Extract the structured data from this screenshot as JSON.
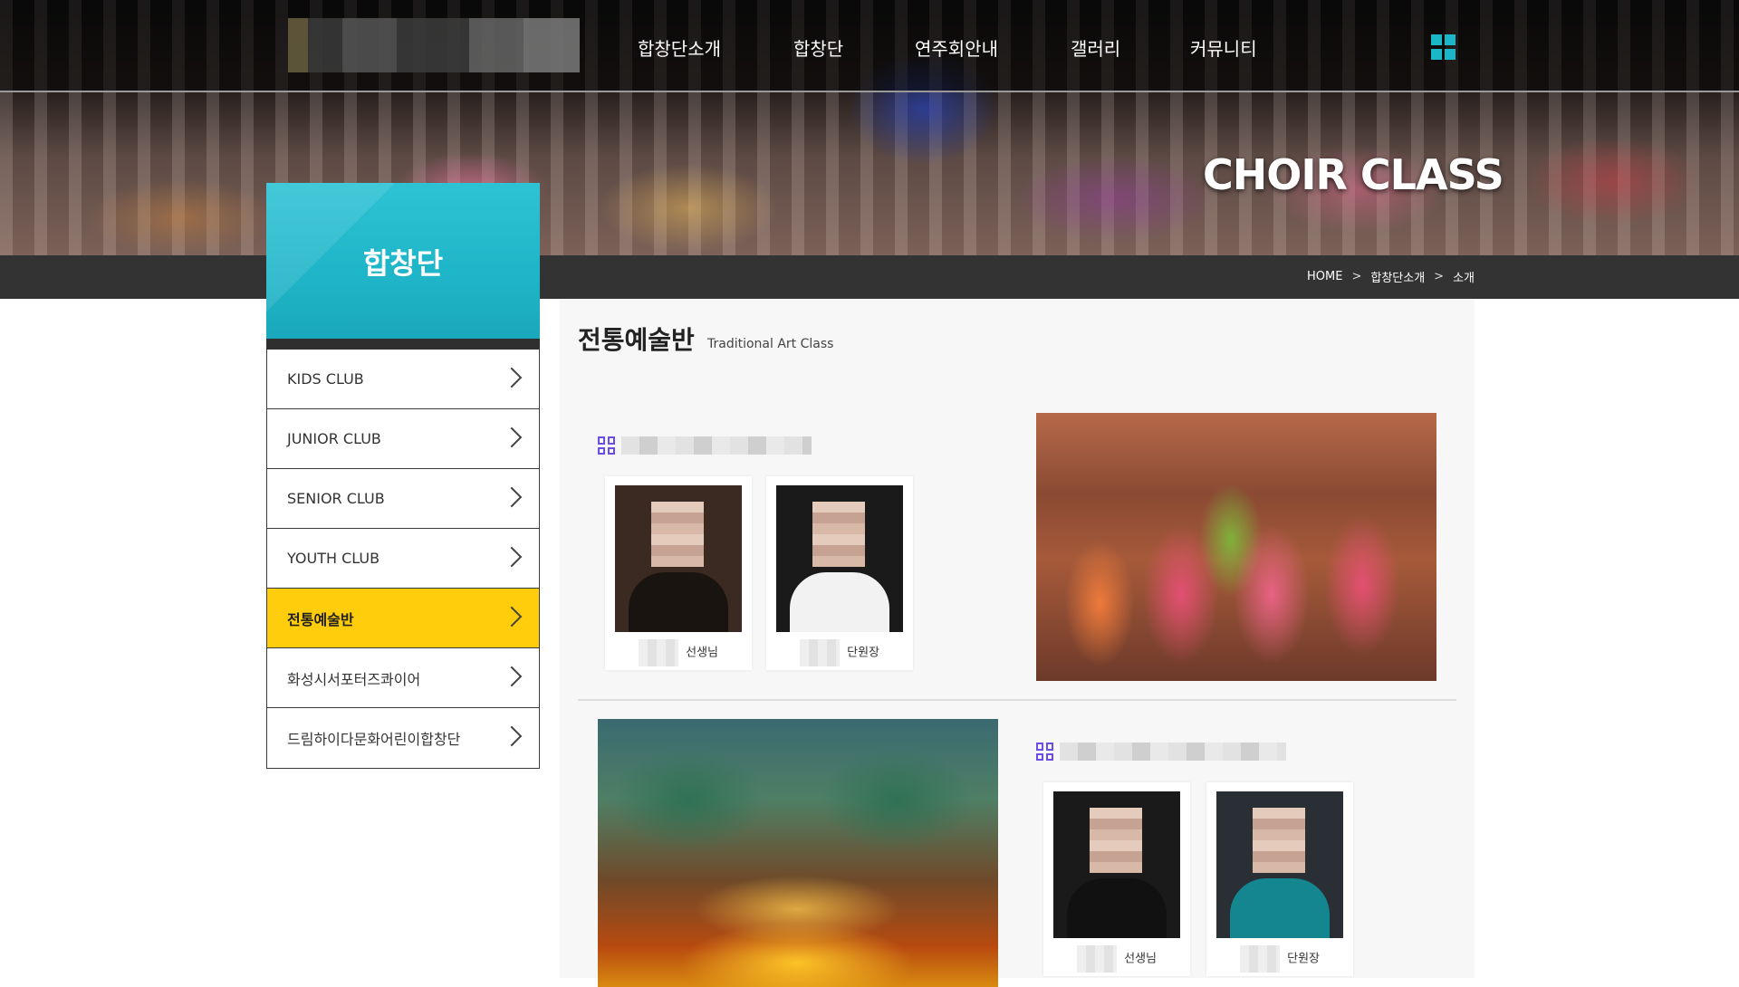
{
  "nav": {
    "items": [
      "합창단소개",
      "합창단",
      "연주회안내",
      "갤러리",
      "커뮤니티"
    ]
  },
  "hero": {
    "title": "CHOIR CLASS"
  },
  "breadcrumb": {
    "home": "HOME",
    "sep": ">",
    "level1": "합창단소개",
    "level2": "소개"
  },
  "sidebar": {
    "title": "합창단",
    "items": [
      {
        "label": "KIDS CLUB",
        "active": false
      },
      {
        "label": "JUNIOR CLUB",
        "active": false
      },
      {
        "label": "SENIOR CLUB",
        "active": false
      },
      {
        "label": "YOUTH CLUB",
        "active": false
      },
      {
        "label": "전통예술반",
        "active": true
      },
      {
        "label": "화성시서포터즈콰이어",
        "active": false
      },
      {
        "label": "드림하이다문화어린이합창단",
        "active": false
      }
    ]
  },
  "content": {
    "title": "전통예술반",
    "subtitle": "Traditional Art Class",
    "group1": {
      "members": [
        {
          "role": "선생님"
        },
        {
          "role": "단원장"
        }
      ]
    },
    "group2": {
      "members": [
        {
          "role": "선생님"
        },
        {
          "role": "단원장"
        }
      ]
    }
  },
  "colors": {
    "accent": "#ffcd0b",
    "header_teal": "#1fb5c8",
    "icon_purple": "#6b4de6",
    "bar": "#333333"
  },
  "icons": {
    "menu": "grid-menu-icon",
    "chevron": "chevron-right-icon",
    "group": "grid-group-icon"
  }
}
